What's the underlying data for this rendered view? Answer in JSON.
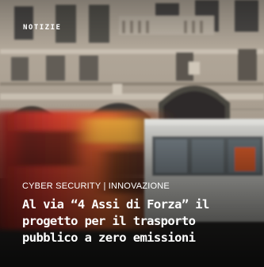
{
  "card": {
    "section_label": "NOTIZIE",
    "categories": {
      "first": "CYBER SECURITY",
      "separator": " | ",
      "second": "INNOVAZIONE"
    },
    "headline_lines": [
      "Al via “4 Assi di Forza” il",
      "progetto per il trasporto",
      "pubblico a zero emissioni"
    ]
  },
  "colors": {
    "text": "#ffffff",
    "building_stone": "#a59a8c",
    "bus_red": "#c8382c",
    "bus_orange": "#e08a2c"
  },
  "image": {
    "subject": "street-with-moving-bus-photo"
  }
}
